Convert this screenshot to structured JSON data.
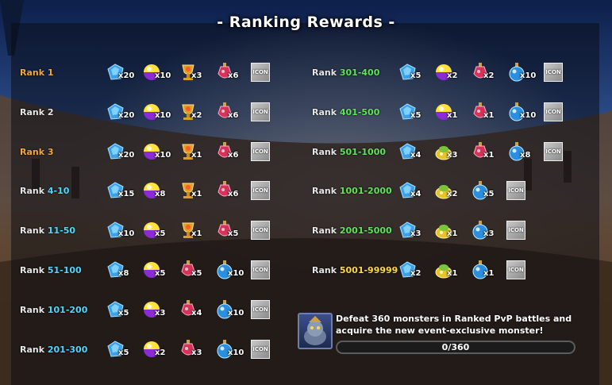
{
  "title": "- Ranking Rewards -",
  "icon_placeholder_text": "ICON",
  "colors": {
    "rank_top": "#f3a73a",
    "rank_cyan": "#4fd7ff",
    "rank_green": "#5fe35a",
    "rank_yellow": "#ffd84a"
  },
  "left_column": [
    {
      "label": "Rank 1",
      "style": "orange",
      "items": [
        {
          "icon": "blue-crystal-icon",
          "qty": "x20"
        },
        {
          "icon": "purple-orb-icon",
          "qty": "x10"
        },
        {
          "icon": "golden-chalice-icon",
          "qty": "x3"
        },
        {
          "icon": "red-potion-icon",
          "qty": "x6"
        }
      ],
      "has_icon_box": true
    },
    {
      "label": "Rank 2",
      "style": "plain",
      "items": [
        {
          "icon": "blue-crystal-icon",
          "qty": "x20"
        },
        {
          "icon": "purple-orb-icon",
          "qty": "x10"
        },
        {
          "icon": "golden-chalice-icon",
          "qty": "x2"
        },
        {
          "icon": "red-potion-icon",
          "qty": "x6"
        }
      ],
      "has_icon_box": true
    },
    {
      "label": "Rank 3",
      "style": "orange",
      "items": [
        {
          "icon": "blue-crystal-icon",
          "qty": "x20"
        },
        {
          "icon": "purple-orb-icon",
          "qty": "x10"
        },
        {
          "icon": "golden-chalice-icon",
          "qty": "x1"
        },
        {
          "icon": "red-potion-icon",
          "qty": "x6"
        }
      ],
      "has_icon_box": true
    },
    {
      "label": "Rank ",
      "num": "4-10",
      "style": "cyan",
      "items": [
        {
          "icon": "blue-crystal-icon",
          "qty": "x15"
        },
        {
          "icon": "purple-orb-icon",
          "qty": "x8"
        },
        {
          "icon": "golden-chalice-icon",
          "qty": "x1"
        },
        {
          "icon": "red-potion-icon",
          "qty": "x6"
        }
      ],
      "has_icon_box": true
    },
    {
      "label": "Rank ",
      "num": "11-50",
      "style": "cyan",
      "items": [
        {
          "icon": "blue-crystal-icon",
          "qty": "x10"
        },
        {
          "icon": "purple-orb-icon",
          "qty": "x5"
        },
        {
          "icon": "golden-chalice-icon",
          "qty": "x1"
        },
        {
          "icon": "red-potion-icon",
          "qty": "x5"
        }
      ],
      "has_icon_box": true
    },
    {
      "label": "Rank ",
      "num": "51-100",
      "style": "cyan",
      "items": [
        {
          "icon": "blue-crystal-icon",
          "qty": "x8"
        },
        {
          "icon": "purple-orb-icon",
          "qty": "x5"
        },
        {
          "icon": "red-potion-icon",
          "qty": "x5"
        },
        {
          "icon": "blue-potion-icon",
          "qty": "x10"
        }
      ],
      "has_icon_box": true
    },
    {
      "label": "Rank ",
      "num": "101-200",
      "style": "cyan",
      "items": [
        {
          "icon": "blue-crystal-icon",
          "qty": "x5"
        },
        {
          "icon": "purple-orb-icon",
          "qty": "x3"
        },
        {
          "icon": "red-potion-icon",
          "qty": "x4"
        },
        {
          "icon": "blue-potion-icon",
          "qty": "x10"
        }
      ],
      "has_icon_box": true
    },
    {
      "label": "Rank ",
      "num": "201-300",
      "style": "cyan",
      "items": [
        {
          "icon": "blue-crystal-icon",
          "qty": "x5"
        },
        {
          "icon": "purple-orb-icon",
          "qty": "x2"
        },
        {
          "icon": "red-potion-icon",
          "qty": "x3"
        },
        {
          "icon": "blue-potion-icon",
          "qty": "x10"
        }
      ],
      "has_icon_box": true
    }
  ],
  "right_column": [
    {
      "label": "Rank ",
      "num": "301-400",
      "style": "green",
      "items": [
        {
          "icon": "blue-crystal-icon",
          "qty": "x5"
        },
        {
          "icon": "purple-orb-icon",
          "qty": "x2"
        },
        {
          "icon": "red-potion-icon",
          "qty": "x2"
        },
        {
          "icon": "blue-potion-icon",
          "qty": "x10"
        }
      ],
      "has_icon_box": true
    },
    {
      "label": "Rank ",
      "num": "401-500",
      "style": "green",
      "items": [
        {
          "icon": "blue-crystal-icon",
          "qty": "x5"
        },
        {
          "icon": "purple-orb-icon",
          "qty": "x1"
        },
        {
          "icon": "red-potion-icon",
          "qty": "x1"
        },
        {
          "icon": "blue-potion-icon",
          "qty": "x10"
        }
      ],
      "has_icon_box": true
    },
    {
      "label": "Rank ",
      "num": "501-1000",
      "style": "green",
      "items": [
        {
          "icon": "blue-crystal-icon",
          "qty": "x4"
        },
        {
          "icon": "gold-coin-pouch-icon",
          "qty": "x3"
        },
        {
          "icon": "red-potion-icon",
          "qty": "x1"
        },
        {
          "icon": "blue-potion-icon",
          "qty": "x8"
        }
      ],
      "has_icon_box": true
    },
    {
      "label": "Rank ",
      "num": "1001-2000",
      "style": "green",
      "items": [
        {
          "icon": "blue-crystal-icon",
          "qty": "x4"
        },
        {
          "icon": "gold-coin-pouch-icon",
          "qty": "x2"
        },
        {
          "icon": "blue-potion-icon",
          "qty": "x5"
        }
      ],
      "has_icon_box": true
    },
    {
      "label": "Rank ",
      "num": "2001-5000",
      "style": "green",
      "items": [
        {
          "icon": "blue-crystal-icon",
          "qty": "x3"
        },
        {
          "icon": "gold-coin-pouch-icon",
          "qty": "x1"
        },
        {
          "icon": "blue-potion-icon",
          "qty": "x3"
        }
      ],
      "has_icon_box": true
    },
    {
      "label": "Rank ",
      "num": "5001-99999",
      "style": "yellow",
      "items": [
        {
          "icon": "blue-crystal-icon",
          "qty": "x2"
        },
        {
          "icon": "gold-coin-pouch-icon",
          "qty": "x1"
        },
        {
          "icon": "blue-potion-icon",
          "qty": "x1"
        }
      ],
      "has_icon_box": true
    }
  ],
  "mission": {
    "description": "Defeat 360 monsters in Ranked PvP battles and acquire the new event-exclusive monster!",
    "progress_text": "0/360",
    "progress_fraction": 0,
    "avatar_icon": "monster-avatar-icon"
  }
}
